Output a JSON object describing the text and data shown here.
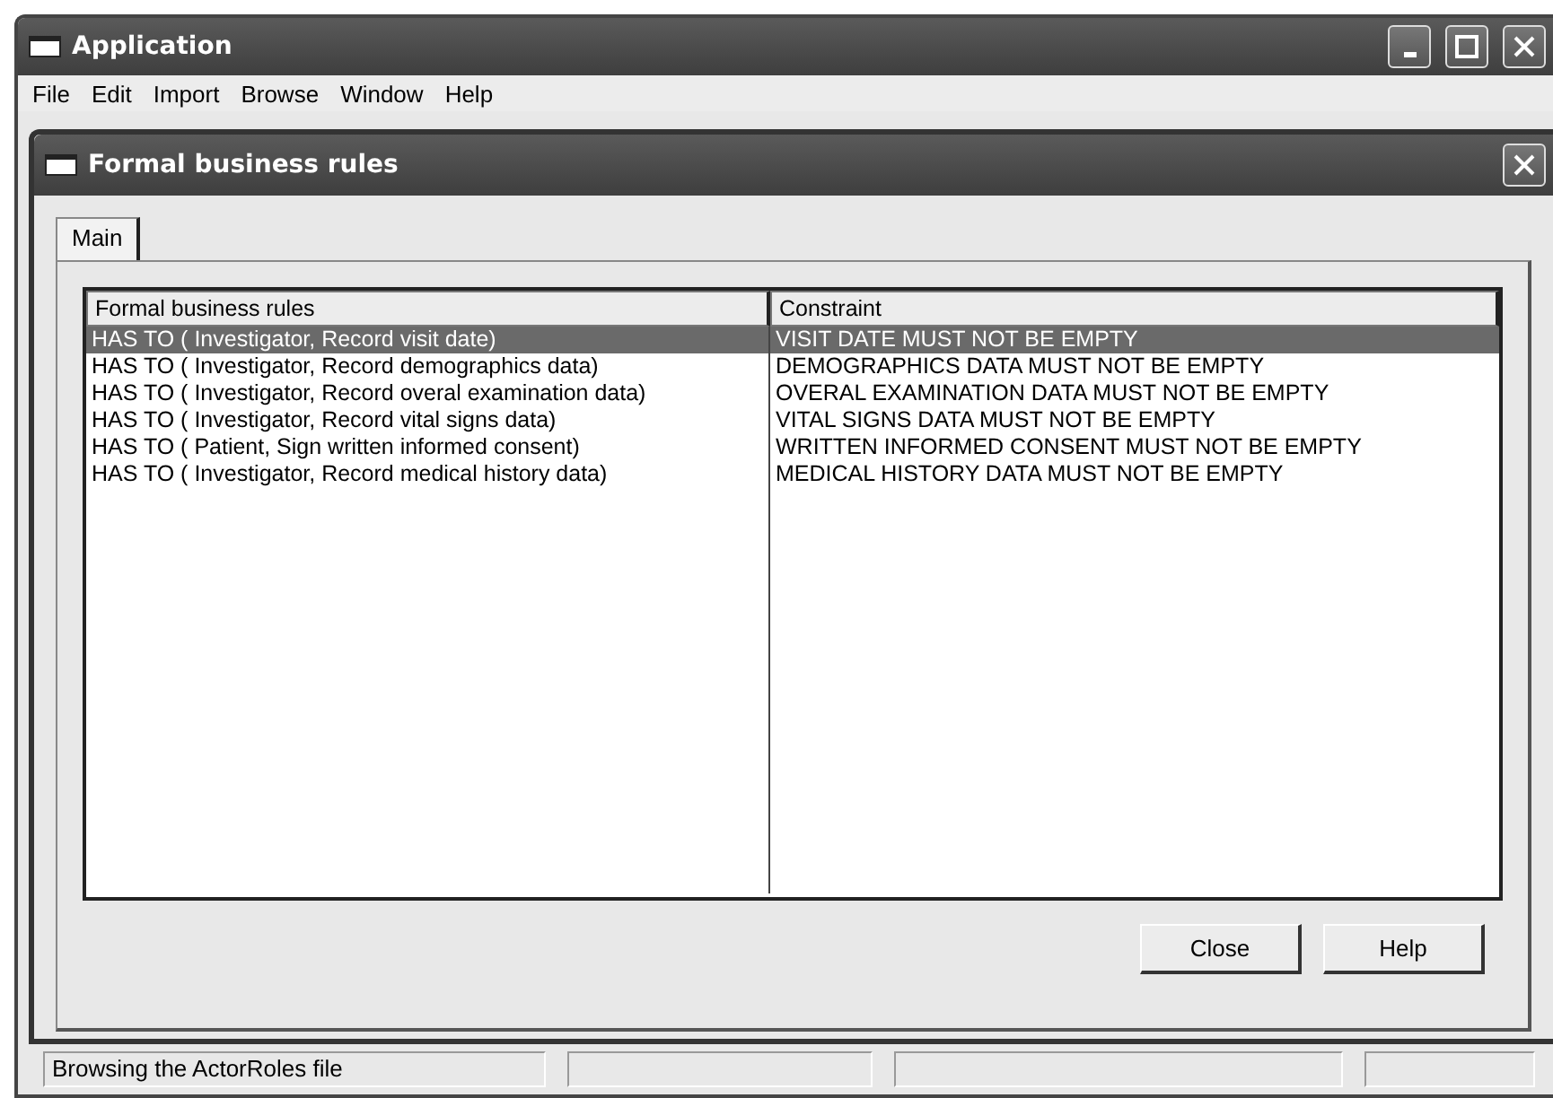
{
  "window": {
    "title": "Application"
  },
  "menu": [
    "File",
    "Edit",
    "Import",
    "Browse",
    "Window",
    "Help"
  ],
  "dialog": {
    "title": "Formal business rules",
    "tabs": [
      {
        "label": "Main",
        "selected": true
      }
    ],
    "table": {
      "columns": [
        "Formal business rules",
        "Constraint"
      ],
      "rows": [
        {
          "cells": [
            "HAS TO ( Investigator,  Record visit date)",
            "VISIT DATE MUST NOT BE EMPTY"
          ],
          "selected": true
        },
        {
          "cells": [
            "HAS TO ( Investigator,  Record demographics data)",
            "DEMOGRAPHICS DATA MUST NOT BE EMPTY"
          ],
          "selected": false
        },
        {
          "cells": [
            "HAS TO ( Investigator,  Record overal examination data)",
            "OVERAL EXAMINATION DATA MUST NOT BE EMPTY"
          ],
          "selected": false
        },
        {
          "cells": [
            "HAS TO ( Investigator,  Record vital signs data)",
            "VITAL SIGNS DATA MUST NOT BE EMPTY"
          ],
          "selected": false
        },
        {
          "cells": [
            "HAS TO ( Patient,  Sign written informed consent)",
            "WRITTEN INFORMED CONSENT MUST NOT BE EMPTY"
          ],
          "selected": false
        },
        {
          "cells": [
            "HAS TO ( Investigator,  Record medical history data)",
            "MEDICAL HISTORY DATA MUST NOT BE EMPTY"
          ],
          "selected": false
        }
      ]
    },
    "buttons": [
      "Close",
      "Help"
    ]
  },
  "status_bar": [
    "Browsing the ActorRoles file"
  ]
}
